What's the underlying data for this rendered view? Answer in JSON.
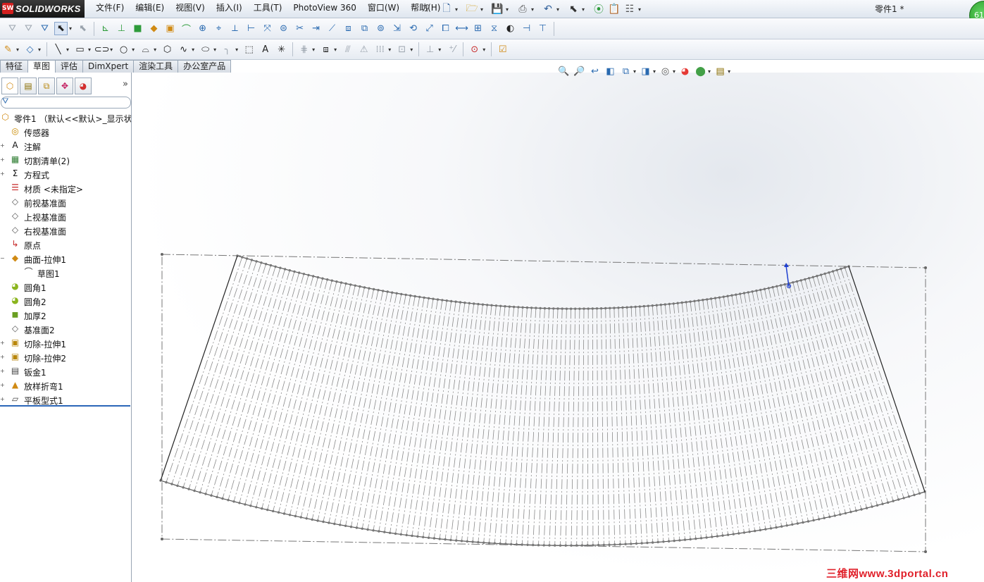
{
  "app": {
    "logo": "SOLIDWORKS",
    "logo_mark": "SW",
    "document_title": "零件1 *",
    "notification_count": "61"
  },
  "menu": [
    "文件(F)",
    "编辑(E)",
    "视图(V)",
    "插入(I)",
    "工具(T)",
    "PhotoView 360",
    "窗口(W)",
    "帮助(H)"
  ],
  "command_tabs": [
    {
      "label": "特征",
      "active": false
    },
    {
      "label": "草图",
      "active": true
    },
    {
      "label": "评估",
      "active": false
    },
    {
      "label": "DimXpert",
      "active": false
    },
    {
      "label": "渲染工具",
      "active": false
    },
    {
      "label": "办公室产品",
      "active": false
    }
  ],
  "feature_tree": [
    {
      "label": "零件1 （默认<<默认>_显示状态",
      "icon": "part-icon",
      "glyph": "⬡",
      "color": "#d08a14",
      "indent": 0,
      "expand": ""
    },
    {
      "label": "传感器",
      "icon": "sensor-icon",
      "glyph": "◎",
      "color": "#c98a00",
      "indent": 1,
      "expand": ""
    },
    {
      "label": "注解",
      "icon": "annotation-icon",
      "glyph": "A",
      "color": "#111111",
      "indent": 1,
      "expand": "+"
    },
    {
      "label": "切割清单(2)",
      "icon": "cut-list-icon",
      "glyph": "▦",
      "color": "#2e7d32",
      "indent": 1,
      "expand": "+"
    },
    {
      "label": "方程式",
      "icon": "equation-icon",
      "glyph": "Σ",
      "color": "#111111",
      "indent": 1,
      "expand": "+"
    },
    {
      "label": "材质 <未指定>",
      "icon": "material-icon",
      "glyph": "☰",
      "color": "#c62828",
      "indent": 1,
      "expand": ""
    },
    {
      "label": "前视基准面",
      "icon": "plane-icon",
      "glyph": "◇",
      "color": "#555555",
      "indent": 1,
      "expand": ""
    },
    {
      "label": "上视基准面",
      "icon": "plane-icon",
      "glyph": "◇",
      "color": "#555555",
      "indent": 1,
      "expand": ""
    },
    {
      "label": "右视基准面",
      "icon": "plane-icon",
      "glyph": "◇",
      "color": "#555555",
      "indent": 1,
      "expand": ""
    },
    {
      "label": "原点",
      "icon": "origin-icon",
      "glyph": "↳",
      "color": "#c62828",
      "indent": 1,
      "expand": ""
    },
    {
      "label": "曲面-拉伸1",
      "icon": "surface-extrude-icon",
      "glyph": "◆",
      "color": "#d08a14",
      "indent": 1,
      "expand": "−"
    },
    {
      "label": "草图1",
      "icon": "sketch-icon",
      "glyph": "⌒",
      "color": "#333333",
      "indent": 2,
      "expand": ""
    },
    {
      "label": "圆角1",
      "icon": "fillet-icon",
      "glyph": "◕",
      "color": "#8bb51e",
      "indent": 1,
      "expand": ""
    },
    {
      "label": "圆角2",
      "icon": "fillet-icon",
      "glyph": "◕",
      "color": "#8bb51e",
      "indent": 1,
      "expand": ""
    },
    {
      "label": "加厚2",
      "icon": "thicken-icon",
      "glyph": "◼",
      "color": "#6a9f22",
      "indent": 1,
      "expand": ""
    },
    {
      "label": "基准面2",
      "icon": "plane-icon",
      "glyph": "◇",
      "color": "#555555",
      "indent": 1,
      "expand": ""
    },
    {
      "label": "切除-拉伸1",
      "icon": "cut-extrude-icon",
      "glyph": "▣",
      "color": "#b8860b",
      "indent": 1,
      "expand": "+"
    },
    {
      "label": "切除-拉伸2",
      "icon": "cut-extrude-icon",
      "glyph": "▣",
      "color": "#b8860b",
      "indent": 1,
      "expand": "+"
    },
    {
      "label": "钣金1",
      "icon": "sheet-metal-icon",
      "glyph": "▤",
      "color": "#444444",
      "indent": 1,
      "expand": "+"
    },
    {
      "label": "放样折弯1",
      "icon": "lofted-bend-icon",
      "glyph": "▲",
      "color": "#d08a14",
      "indent": 1,
      "expand": "+"
    },
    {
      "label": "平板型式1",
      "icon": "flat-pattern-icon",
      "glyph": "▱",
      "color": "#444444",
      "indent": 1,
      "expand": "+"
    }
  ],
  "watermark": "三维网www.3dportal.cn"
}
